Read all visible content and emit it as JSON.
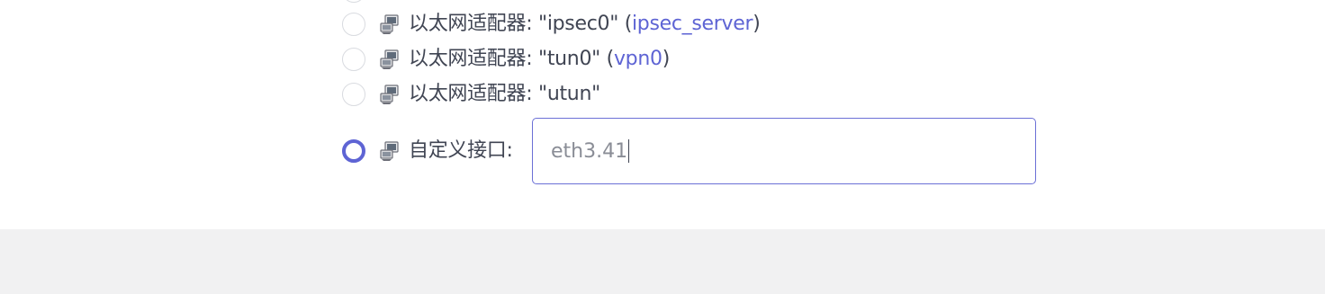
{
  "interfaces": [
    {
      "label": "以太网适配器: \"ipsec0\"",
      "paren_open": " (",
      "network": "ipsec_server",
      "paren_close": ")",
      "selected": false
    },
    {
      "label": "以太网适配器: \"tun0\"",
      "paren_open": " (",
      "network": "vpn0",
      "paren_close": ")",
      "selected": false
    },
    {
      "label": "以太网适配器: \"utun\"",
      "selected": false
    }
  ],
  "custom": {
    "label": "自定义接口:",
    "value": "eth3.41",
    "selected": true
  },
  "icons": {
    "interface": "network-adapter-icon"
  },
  "colors": {
    "accent": "#5e64d4",
    "text": "#404553",
    "footer_bg": "#f1f1f2"
  }
}
